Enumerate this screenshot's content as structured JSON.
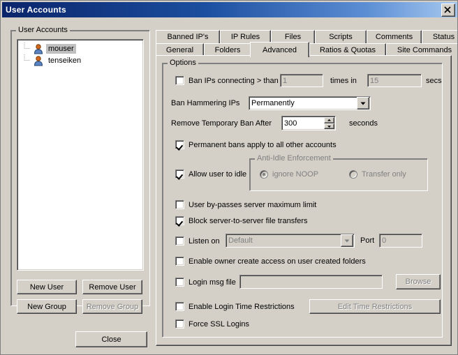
{
  "window": {
    "title": "User Accounts",
    "close_label": "Close window",
    "close_icon": "close-icon"
  },
  "left_panel": {
    "group_title": "User Accounts",
    "users": [
      {
        "name": "mouser",
        "selected": true,
        "icon": "user-icon"
      },
      {
        "name": "tenseiken",
        "selected": false,
        "icon": "user-icon"
      }
    ],
    "buttons": [
      {
        "label": "New User",
        "disabled": false
      },
      {
        "label": "Remove User",
        "disabled": false
      },
      {
        "label": "New Group",
        "disabled": false
      },
      {
        "label": "Remove Group",
        "disabled": true
      }
    ],
    "close_button": {
      "label": "Close",
      "disabled": false
    }
  },
  "tabs": {
    "row1": [
      {
        "label": "Banned IP's",
        "active": false
      },
      {
        "label": "IP Rules",
        "active": false
      },
      {
        "label": "Files",
        "active": false
      },
      {
        "label": "Scripts",
        "active": false
      },
      {
        "label": "Comments",
        "active": false
      },
      {
        "label": "Status",
        "active": false
      }
    ],
    "row2": [
      {
        "label": "General",
        "active": false
      },
      {
        "label": "Folders",
        "active": false
      },
      {
        "label": "Advanced",
        "active": true
      },
      {
        "label": "Ratios & Quotas",
        "active": false
      },
      {
        "label": "Site Commands",
        "active": false
      }
    ]
  },
  "options": {
    "group_title": "Options",
    "ban_ips": {
      "checkbox_label": "Ban IPs connecting > than",
      "checked": false,
      "count_value": "1",
      "count_disabled": true,
      "mid_label": "times in",
      "secs_value": "15",
      "secs_disabled": true,
      "suffix_label": "secs"
    },
    "ban_hammering": {
      "label": "Ban Hammering IPs",
      "value": "Permanently",
      "disabled": false,
      "arrow_icon": "chevron-down-icon"
    },
    "remove_temp_ban": {
      "label": "Remove Temporary Ban After",
      "value": "300",
      "suffix_label": "seconds",
      "up_icon": "spinner-up-icon",
      "down_icon": "spinner-down-icon"
    },
    "permanent_bans": {
      "label": "Permanent bans apply to all other accounts",
      "checked": true
    },
    "allow_idle": {
      "label": "Allow user to idle",
      "checked": true
    },
    "anti_idle": {
      "group_title": "Anti-Idle Enforcement",
      "disabled": true,
      "radios": [
        {
          "label": "ignore NOOP",
          "selected": true
        },
        {
          "label": "Transfer only",
          "selected": false
        }
      ]
    },
    "bypass_max": {
      "label": "User by-passes server maximum limit",
      "checked": false
    },
    "block_fxp": {
      "label": "Block server-to-server file transfers",
      "checked": true
    },
    "listen_on": {
      "label": "Listen on",
      "checked": false,
      "value": "Default",
      "disabled": true,
      "arrow_icon": "chevron-down-icon",
      "port_label": "Port",
      "port_value": "0",
      "port_disabled": true
    },
    "owner_create": {
      "label": "Enable owner create access on user created folders",
      "checked": false
    },
    "login_msg": {
      "label": "Login msg file",
      "checked": false,
      "value": "",
      "disabled": true,
      "browse_label": "Browse",
      "browse_disabled": true
    },
    "login_time": {
      "label": "Enable Login Time Restrictions",
      "checked": false,
      "button_label": "Edit Time Restrictions",
      "button_disabled": true
    },
    "force_ssl": {
      "label": "Force SSL Logins",
      "checked": false
    }
  }
}
